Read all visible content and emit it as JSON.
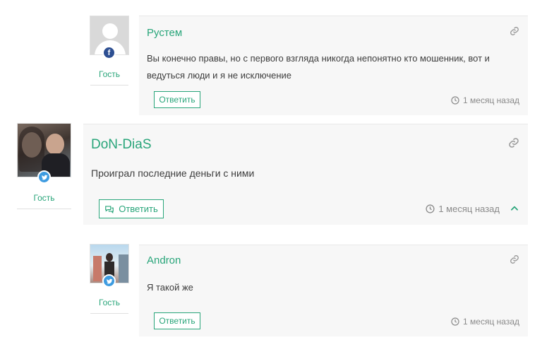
{
  "comments": [
    {
      "author": "Рустем",
      "role": "Гость",
      "social": "facebook-icon",
      "text": "Вы конечно правы, но с первого взгляда никогда непонятно кто мошенник, вот и ведуться люди и я не исключение",
      "reply_label": "Ответить",
      "time": "1 месяц назад"
    },
    {
      "author": "DoN-DiaS",
      "role": "Гость",
      "social": "twitter-icon",
      "text": "Проиграл последние деньги с ними",
      "reply_label": "Ответить",
      "time": "1 месяц назад",
      "toggle": "chevron-up-icon"
    },
    {
      "author": "Andron",
      "role": "Гость",
      "social": "twitter-icon",
      "text": "Я такой же",
      "reply_label": "Ответить",
      "time": "1 месяц назад"
    }
  ],
  "colors": {
    "accent": "#29a57a",
    "card_bg": "#f7f7f7",
    "facebook": "#2d4f92",
    "twitter": "#3d9be0"
  }
}
